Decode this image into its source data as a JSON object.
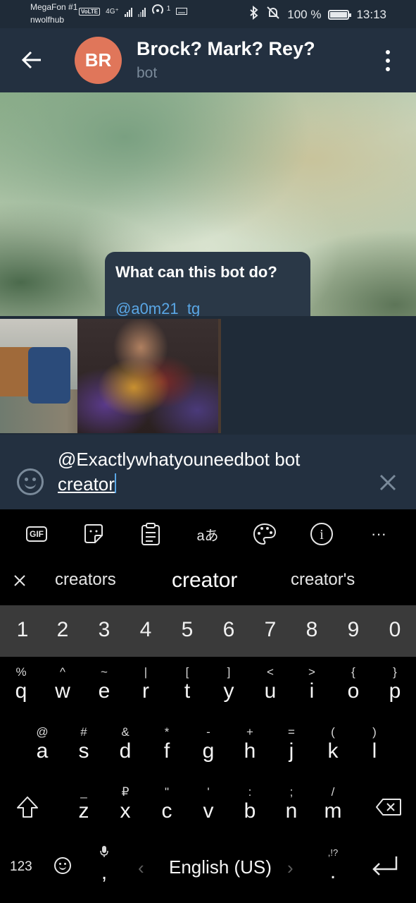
{
  "status_bar": {
    "carrier": "MegaFon #1",
    "carrier2": "nwolfhub",
    "volte": "VoLTE",
    "net": "4G⁺",
    "hotspot_count": "1",
    "battery": "100 %",
    "time": "13:13"
  },
  "header": {
    "avatar_initials": "BR",
    "avatar_color": "#e0765a",
    "title": "Brock? Mark? Rey?",
    "subtitle": "bot"
  },
  "chat": {
    "bubble_title": "What can this bot do?",
    "bubble_link": "@a0m21_tg"
  },
  "input": {
    "line1": "@Exactlywhatyouneedbot bot",
    "line2": "creator"
  },
  "keyboard": {
    "toolbar": [
      "gif-icon",
      "sticker-icon",
      "clipboard-icon",
      "translate-icon",
      "theme-icon",
      "info-icon",
      "more-icon"
    ],
    "gif_label": "GIF",
    "more_label": "···",
    "translate_label": "aあ",
    "info_label": "i",
    "suggestions": [
      "creators",
      "creator",
      "creator's"
    ],
    "numbers": [
      "1",
      "2",
      "3",
      "4",
      "5",
      "6",
      "7",
      "8",
      "9",
      "0"
    ],
    "row1": [
      {
        "sec": "%",
        "pri": "q"
      },
      {
        "sec": "^",
        "pri": "w"
      },
      {
        "sec": "~",
        "pri": "e"
      },
      {
        "sec": "|",
        "pri": "r"
      },
      {
        "sec": "[",
        "pri": "t"
      },
      {
        "sec": "]",
        "pri": "y"
      },
      {
        "sec": "<",
        "pri": "u"
      },
      {
        "sec": ">",
        "pri": "i"
      },
      {
        "sec": "{",
        "pri": "o"
      },
      {
        "sec": "}",
        "pri": "p"
      }
    ],
    "row2": [
      {
        "sec": "@",
        "pri": "a"
      },
      {
        "sec": "#",
        "pri": "s"
      },
      {
        "sec": "&",
        "pri": "d"
      },
      {
        "sec": "*",
        "pri": "f"
      },
      {
        "sec": "-",
        "pri": "g"
      },
      {
        "sec": "+",
        "pri": "h"
      },
      {
        "sec": "=",
        "pri": "j"
      },
      {
        "sec": "(",
        "pri": "k"
      },
      {
        "sec": ")",
        "pri": "l"
      }
    ],
    "row3": [
      {
        "sec": "_",
        "pri": "z"
      },
      {
        "sec": "₽",
        "pri": "x"
      },
      {
        "sec": "\"",
        "pri": "c"
      },
      {
        "sec": "'",
        "pri": "v"
      },
      {
        "sec": ":",
        "pri": "b"
      },
      {
        "sec": ";",
        "pri": "n"
      },
      {
        "sec": "/",
        "pri": "m"
      }
    ],
    "num_switch": "123",
    "comma_sec": "🎤",
    "comma": ",",
    "space": "English (US)",
    "period_sec": ",!?",
    "period": "."
  }
}
